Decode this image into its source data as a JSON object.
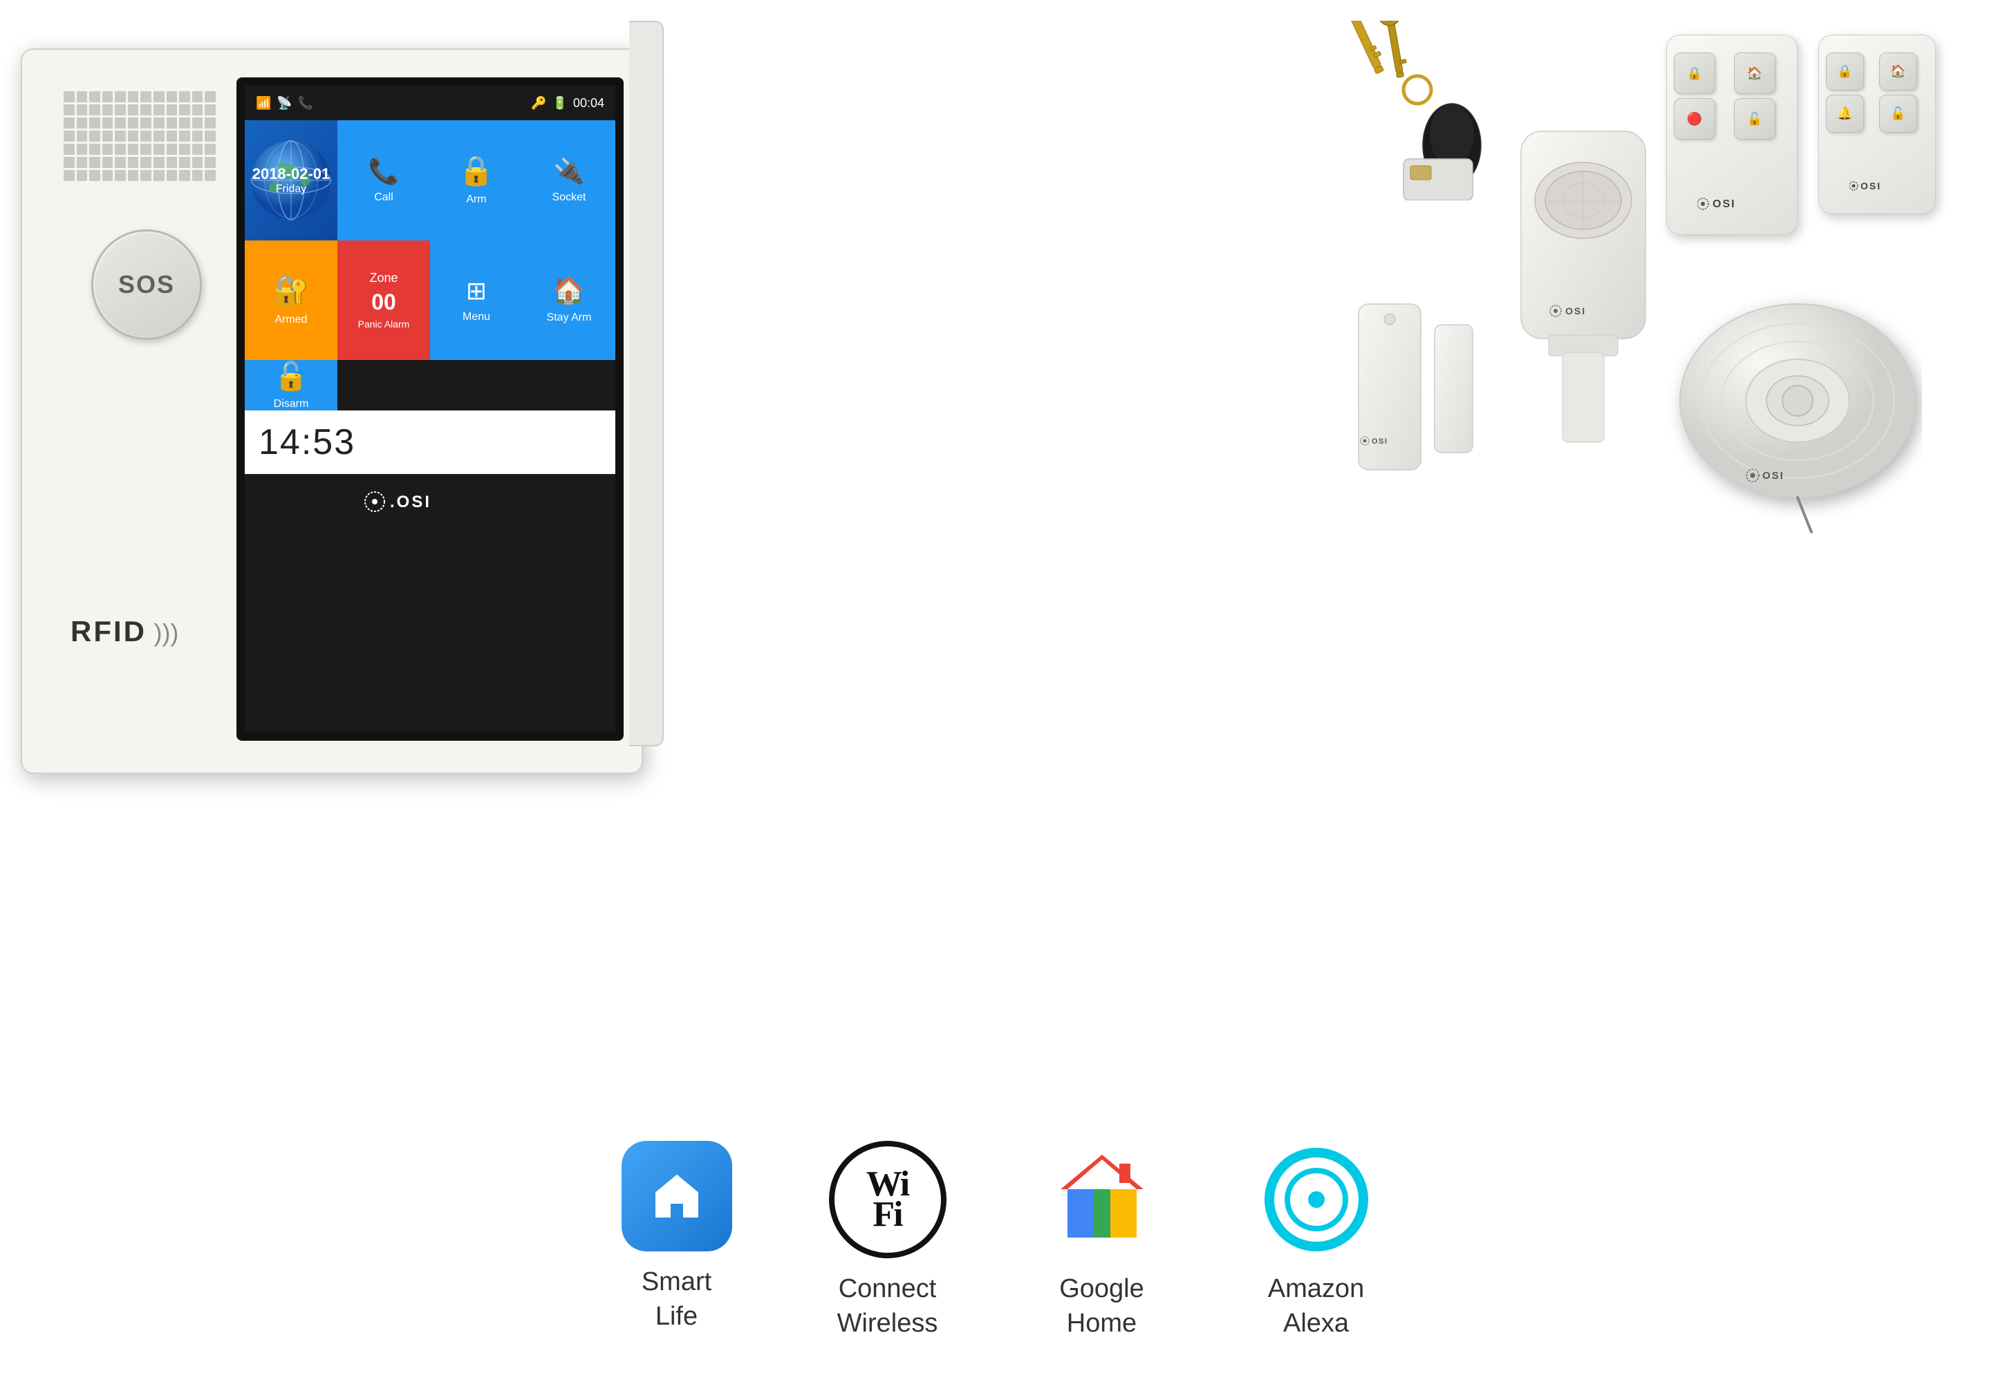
{
  "panel": {
    "sos_label": "SOS",
    "rfid_label": "RFID",
    "screen": {
      "date": "2018-02-01",
      "day": "Friday",
      "time": "14:53",
      "status_time": "00:04",
      "tiles": [
        {
          "id": "call",
          "label": "Call",
          "color": "#2196F3"
        },
        {
          "id": "arm",
          "label": "Arm",
          "color": "#2196F3"
        },
        {
          "id": "socket",
          "label": "Socket",
          "color": "#2196F3"
        },
        {
          "id": "armed",
          "label": "Armed",
          "color": "#FF9800"
        },
        {
          "id": "panic",
          "label": "Panic Alarm",
          "color": "#e53935"
        },
        {
          "id": "menu",
          "label": "Menu",
          "color": "#2196F3"
        },
        {
          "id": "stay_arm",
          "label": "Stay Arm",
          "color": "#2196F3"
        },
        {
          "id": "disarm",
          "label": "Disarm",
          "color": "#2196F3"
        }
      ],
      "zone_number": "00",
      "zone_label": "Zone"
    },
    "osi_logo": ".OSI"
  },
  "accessories": {
    "pir_logo": "〇.OSI",
    "door_logo": "〇.OSI",
    "siren_logo": "〇.OSI"
  },
  "bottom_apps": [
    {
      "id": "smart-life",
      "label": "Smart\nLife"
    },
    {
      "id": "wifi",
      "label": "Connect\nWireless"
    },
    {
      "id": "google-home",
      "label": "Google\nHome"
    },
    {
      "id": "alexa",
      "label": "Amazon\nAlexa"
    }
  ],
  "remotes": {
    "logo": "〈OSI",
    "buttons": [
      "🔒",
      "🏠",
      "🔔",
      "🔓"
    ]
  }
}
